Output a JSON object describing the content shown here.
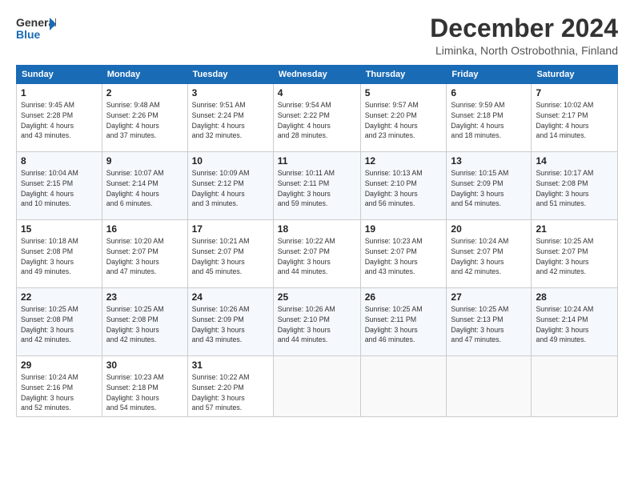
{
  "header": {
    "logo_line1": "General",
    "logo_line2": "Blue",
    "title": "December 2024",
    "subtitle": "Liminka, North Ostrobothnia, Finland"
  },
  "weekdays": [
    "Sunday",
    "Monday",
    "Tuesday",
    "Wednesday",
    "Thursday",
    "Friday",
    "Saturday"
  ],
  "weeks": [
    [
      {
        "day": "1",
        "info": "Sunrise: 9:45 AM\nSunset: 2:28 PM\nDaylight: 4 hours\nand 43 minutes."
      },
      {
        "day": "2",
        "info": "Sunrise: 9:48 AM\nSunset: 2:26 PM\nDaylight: 4 hours\nand 37 minutes."
      },
      {
        "day": "3",
        "info": "Sunrise: 9:51 AM\nSunset: 2:24 PM\nDaylight: 4 hours\nand 32 minutes."
      },
      {
        "day": "4",
        "info": "Sunrise: 9:54 AM\nSunset: 2:22 PM\nDaylight: 4 hours\nand 28 minutes."
      },
      {
        "day": "5",
        "info": "Sunrise: 9:57 AM\nSunset: 2:20 PM\nDaylight: 4 hours\nand 23 minutes."
      },
      {
        "day": "6",
        "info": "Sunrise: 9:59 AM\nSunset: 2:18 PM\nDaylight: 4 hours\nand 18 minutes."
      },
      {
        "day": "7",
        "info": "Sunrise: 10:02 AM\nSunset: 2:17 PM\nDaylight: 4 hours\nand 14 minutes."
      }
    ],
    [
      {
        "day": "8",
        "info": "Sunrise: 10:04 AM\nSunset: 2:15 PM\nDaylight: 4 hours\nand 10 minutes."
      },
      {
        "day": "9",
        "info": "Sunrise: 10:07 AM\nSunset: 2:14 PM\nDaylight: 4 hours\nand 6 minutes."
      },
      {
        "day": "10",
        "info": "Sunrise: 10:09 AM\nSunset: 2:12 PM\nDaylight: 4 hours\nand 3 minutes."
      },
      {
        "day": "11",
        "info": "Sunrise: 10:11 AM\nSunset: 2:11 PM\nDaylight: 3 hours\nand 59 minutes."
      },
      {
        "day": "12",
        "info": "Sunrise: 10:13 AM\nSunset: 2:10 PM\nDaylight: 3 hours\nand 56 minutes."
      },
      {
        "day": "13",
        "info": "Sunrise: 10:15 AM\nSunset: 2:09 PM\nDaylight: 3 hours\nand 54 minutes."
      },
      {
        "day": "14",
        "info": "Sunrise: 10:17 AM\nSunset: 2:08 PM\nDaylight: 3 hours\nand 51 minutes."
      }
    ],
    [
      {
        "day": "15",
        "info": "Sunrise: 10:18 AM\nSunset: 2:08 PM\nDaylight: 3 hours\nand 49 minutes."
      },
      {
        "day": "16",
        "info": "Sunrise: 10:20 AM\nSunset: 2:07 PM\nDaylight: 3 hours\nand 47 minutes."
      },
      {
        "day": "17",
        "info": "Sunrise: 10:21 AM\nSunset: 2:07 PM\nDaylight: 3 hours\nand 45 minutes."
      },
      {
        "day": "18",
        "info": "Sunrise: 10:22 AM\nSunset: 2:07 PM\nDaylight: 3 hours\nand 44 minutes."
      },
      {
        "day": "19",
        "info": "Sunrise: 10:23 AM\nSunset: 2:07 PM\nDaylight: 3 hours\nand 43 minutes."
      },
      {
        "day": "20",
        "info": "Sunrise: 10:24 AM\nSunset: 2:07 PM\nDaylight: 3 hours\nand 42 minutes."
      },
      {
        "day": "21",
        "info": "Sunrise: 10:25 AM\nSunset: 2:07 PM\nDaylight: 3 hours\nand 42 minutes."
      }
    ],
    [
      {
        "day": "22",
        "info": "Sunrise: 10:25 AM\nSunset: 2:08 PM\nDaylight: 3 hours\nand 42 minutes."
      },
      {
        "day": "23",
        "info": "Sunrise: 10:25 AM\nSunset: 2:08 PM\nDaylight: 3 hours\nand 42 minutes."
      },
      {
        "day": "24",
        "info": "Sunrise: 10:26 AM\nSunset: 2:09 PM\nDaylight: 3 hours\nand 43 minutes."
      },
      {
        "day": "25",
        "info": "Sunrise: 10:26 AM\nSunset: 2:10 PM\nDaylight: 3 hours\nand 44 minutes."
      },
      {
        "day": "26",
        "info": "Sunrise: 10:25 AM\nSunset: 2:11 PM\nDaylight: 3 hours\nand 46 minutes."
      },
      {
        "day": "27",
        "info": "Sunrise: 10:25 AM\nSunset: 2:13 PM\nDaylight: 3 hours\nand 47 minutes."
      },
      {
        "day": "28",
        "info": "Sunrise: 10:24 AM\nSunset: 2:14 PM\nDaylight: 3 hours\nand 49 minutes."
      }
    ],
    [
      {
        "day": "29",
        "info": "Sunrise: 10:24 AM\nSunset: 2:16 PM\nDaylight: 3 hours\nand 52 minutes."
      },
      {
        "day": "30",
        "info": "Sunrise: 10:23 AM\nSunset: 2:18 PM\nDaylight: 3 hours\nand 54 minutes."
      },
      {
        "day": "31",
        "info": "Sunrise: 10:22 AM\nSunset: 2:20 PM\nDaylight: 3 hours\nand 57 minutes."
      },
      {
        "day": "",
        "info": ""
      },
      {
        "day": "",
        "info": ""
      },
      {
        "day": "",
        "info": ""
      },
      {
        "day": "",
        "info": ""
      }
    ]
  ]
}
